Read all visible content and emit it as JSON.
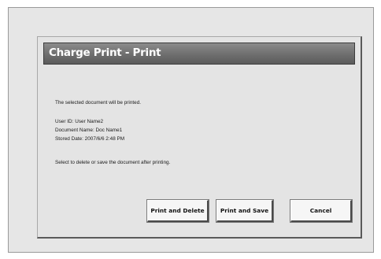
{
  "dialog": {
    "title": "Charge Print - Print",
    "message": "The selected document will be printed.",
    "user_id": "User ID: User Name2",
    "document_name": "Document Name: Doc Name1",
    "stored_date": "Stored Date: 2007/6/6 2:48 PM",
    "instruction": "Select to delete or save the document after printing."
  },
  "buttons": {
    "print_and_delete": "Print and Delete",
    "print_and_save": "Print and Save",
    "cancel": "Cancel"
  },
  "colors": {
    "screen_bg": "#e6e6e6",
    "title_bar": "#6e6e6e",
    "title_text": "#ffffff",
    "button_bg": "#f6f6f6"
  }
}
